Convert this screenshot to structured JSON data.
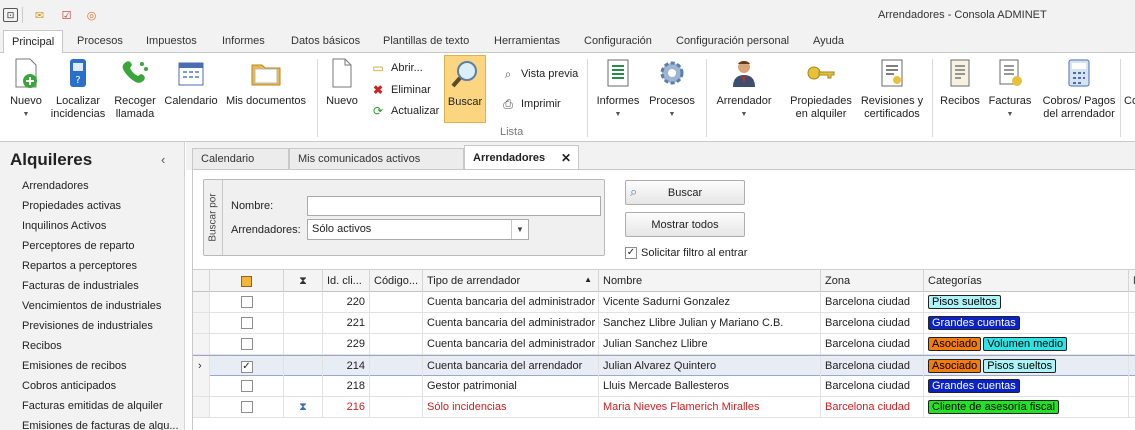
{
  "window": {
    "title": "Arrendadores - Consola ADMINET"
  },
  "ribbon_tabs": [
    "Principal",
    "Procesos",
    "Impuestos",
    "Informes",
    "Datos básicos",
    "Plantillas de texto",
    "Herramientas",
    "Configuración",
    "Configuración personal",
    "Ayuda"
  ],
  "ribbon": {
    "nuevo": "Nuevo",
    "localizar": "Localizar",
    "localizar2": "incidencias",
    "recoger": "Recoger",
    "recoger2": "llamada",
    "calendario": "Calendario",
    "mis_documentos": "Mis documentos",
    "nuevo2": "Nuevo",
    "abrir": "Abrir...",
    "eliminar": "Eliminar",
    "actualizar": "Actualizar",
    "buscar": "Buscar",
    "vista_previa": "Vista previa",
    "imprimir": "Imprimir",
    "group_lista": "Lista",
    "informes": "Informes",
    "procesos": "Procesos",
    "arrendador": "Arrendador",
    "propiedades": "Propiedades",
    "propiedades2": "en alquiler",
    "revisiones": "Revisiones y",
    "revisiones2": "certificados",
    "recibos": "Recibos",
    "facturas": "Facturas",
    "cobros": "Cobros/ Pagos",
    "cobros2": "del arrendador",
    "co": "Co"
  },
  "left_panel": {
    "title": "Alquileres",
    "items": [
      "Arrendadores",
      "Propiedades activas",
      "Inquilinos Activos",
      "Perceptores de reparto",
      "Repartos a perceptores",
      "Facturas de industriales",
      "Vencimientos de industriales",
      "Previsiones de industriales",
      "Recibos",
      "Emisiones de recibos",
      "Cobros anticipados",
      "Facturas emitidas de alquiler",
      "Emisiones de facturas de alqu..."
    ]
  },
  "doc_tabs": [
    "Calendario",
    "Mis comunicados activos",
    "Arrendadores"
  ],
  "search": {
    "group_label": "Buscar por",
    "nombre_label": "Nombre:",
    "nombre_value": "",
    "arrendadores_label": "Arrendadores:",
    "arrendadores_value": "Sólo activos",
    "buscar_button": "Buscar",
    "mostrar_todos_button": "Mostrar todos",
    "solicitar_filtro": "Solicitar filtro al entrar"
  },
  "grid": {
    "columns": [
      "Id. cli...",
      "Código...",
      "Tipo de arrendador",
      "Nombre",
      "Zona",
      "Categorías",
      "N"
    ],
    "rows": [
      {
        "id": "220",
        "codigo": "",
        "tipo": "Cuenta bancaria del administrador",
        "nombre": "Vicente Sadurni Gonzalez",
        "zona": "Barcelona ciudad",
        "checked": false,
        "hourglass": false,
        "red": false,
        "selected": false,
        "tags": [
          {
            "text": "Pisos sueltos",
            "bg": "#aef3f7",
            "fg": "#000000"
          }
        ]
      },
      {
        "id": "221",
        "codigo": "",
        "tipo": "Cuenta bancaria del administrador",
        "nombre": "Sanchez Llibre Julian y Mariano C.B.",
        "zona": "Barcelona ciudad",
        "checked": false,
        "hourglass": false,
        "red": false,
        "selected": false,
        "tags": [
          {
            "text": "Grandes cuentas",
            "bg": "#0a22c8",
            "fg": "#ffffff"
          }
        ]
      },
      {
        "id": "229",
        "codigo": "",
        "tipo": "Cuenta bancaria del administrador",
        "nombre": "Julian Sanchez Llibre",
        "zona": "Barcelona ciudad",
        "checked": false,
        "hourglass": false,
        "red": false,
        "selected": false,
        "tags": [
          {
            "text": "Asociado",
            "bg": "#f27c0c",
            "fg": "#000000"
          },
          {
            "text": "Volumen medio",
            "bg": "#2ee3e3",
            "fg": "#000000"
          }
        ]
      },
      {
        "id": "214",
        "codigo": "",
        "tipo": "Cuenta bancaria del arrendador",
        "nombre": "Julian Alvarez Quintero",
        "zona": "Barcelona ciudad",
        "checked": true,
        "hourglass": false,
        "red": false,
        "selected": true,
        "tags": [
          {
            "text": "Asociado",
            "bg": "#f27c0c",
            "fg": "#000000"
          },
          {
            "text": "Pisos sueltos",
            "bg": "#aef3f7",
            "fg": "#000000"
          }
        ]
      },
      {
        "id": "218",
        "codigo": "",
        "tipo": "Gestor patrimonial",
        "nombre": "Lluis Mercade Ballesteros",
        "zona": "Barcelona ciudad",
        "checked": false,
        "hourglass": false,
        "red": false,
        "selected": false,
        "tags": [
          {
            "text": "Grandes cuentas",
            "bg": "#0a22c8",
            "fg": "#ffffff"
          }
        ]
      },
      {
        "id": "216",
        "codigo": "",
        "tipo": "Sólo incidencias",
        "nombre": "Maria Nieves Flamerich Miralles",
        "zona": "Barcelona ciudad",
        "checked": false,
        "hourglass": true,
        "red": true,
        "selected": false,
        "tags": [
          {
            "text": "Cliente de asesoría fiscal",
            "bg": "#22e322",
            "fg": "#000000"
          }
        ]
      }
    ]
  },
  "colors": {
    "accent": "#fbd57f",
    "red_text": "#d02020",
    "tab_active_border": "#c8c8c8"
  }
}
